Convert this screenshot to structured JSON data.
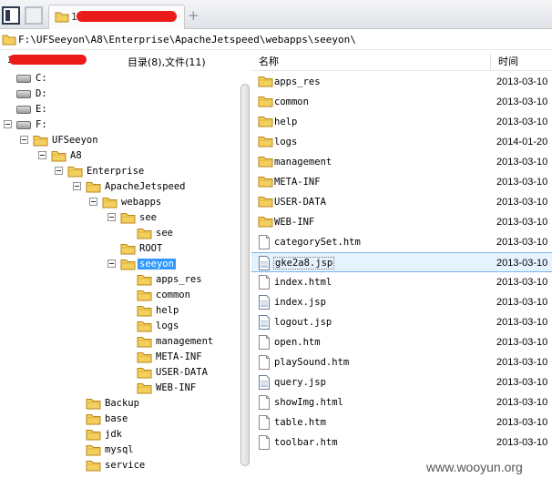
{
  "tab": {
    "title": "11..."
  },
  "path": {
    "text": "F:\\UFSeeyon\\A8\\Enterprise\\ApacheJetspeed\\webapps\\seeyon\\"
  },
  "left_header": {
    "host": "11...",
    "counts": "目录(8),文件(11)"
  },
  "tree": {
    "nodes": [
      {
        "label": "C:",
        "kind": "drive"
      },
      {
        "label": "D:",
        "kind": "drive"
      },
      {
        "label": "E:",
        "kind": "drive"
      },
      {
        "label": "F:",
        "kind": "drive"
      },
      {
        "label": "UFSeeyon",
        "kind": "folder"
      },
      {
        "label": "A8",
        "kind": "folder"
      },
      {
        "label": "Enterprise",
        "kind": "folder"
      },
      {
        "label": "ApacheJetspeed",
        "kind": "folder"
      },
      {
        "label": "webapps",
        "kind": "folder"
      },
      {
        "label": "see",
        "kind": "folder"
      },
      {
        "label": "see",
        "kind": "folder"
      },
      {
        "label": "ROOT",
        "kind": "folder"
      },
      {
        "label": "seeyon",
        "kind": "folder",
        "selected": true
      },
      {
        "label": "apps_res",
        "kind": "folder"
      },
      {
        "label": "common",
        "kind": "folder"
      },
      {
        "label": "help",
        "kind": "folder"
      },
      {
        "label": "logs",
        "kind": "folder"
      },
      {
        "label": "management",
        "kind": "folder"
      },
      {
        "label": "META-INF",
        "kind": "folder"
      },
      {
        "label": "USER-DATA",
        "kind": "folder"
      },
      {
        "label": "WEB-INF",
        "kind": "folder"
      },
      {
        "label": "Backup",
        "kind": "folder"
      },
      {
        "label": "base",
        "kind": "folder"
      },
      {
        "label": "jdk",
        "kind": "folder"
      },
      {
        "label": "mysql",
        "kind": "folder"
      },
      {
        "label": "service",
        "kind": "folder"
      }
    ]
  },
  "columns": {
    "name": "名称",
    "time": "时间"
  },
  "files": [
    {
      "name": "apps_res",
      "type": "folder",
      "time": "2013-03-10"
    },
    {
      "name": "common",
      "type": "folder",
      "time": "2013-03-10"
    },
    {
      "name": "help",
      "type": "folder",
      "time": "2013-03-10"
    },
    {
      "name": "logs",
      "type": "folder",
      "time": "2014-01-20"
    },
    {
      "name": "management",
      "type": "folder",
      "time": "2013-03-10"
    },
    {
      "name": "META-INF",
      "type": "folder",
      "time": "2013-03-10"
    },
    {
      "name": "USER-DATA",
      "type": "folder",
      "time": "2013-03-10"
    },
    {
      "name": "WEB-INF",
      "type": "folder",
      "time": "2013-03-10"
    },
    {
      "name": "categorySet.htm",
      "type": "doc",
      "time": "2013-03-10"
    },
    {
      "name": "gke2a8.jsp",
      "type": "jsp",
      "time": "2013-03-10",
      "selected": true
    },
    {
      "name": "index.html",
      "type": "doc",
      "time": "2013-03-10"
    },
    {
      "name": "index.jsp",
      "type": "jsp",
      "time": "2013-03-10"
    },
    {
      "name": "logout.jsp",
      "type": "jsp",
      "time": "2013-03-10"
    },
    {
      "name": "open.htm",
      "type": "doc",
      "time": "2013-03-10"
    },
    {
      "name": "playSound.htm",
      "type": "doc",
      "time": "2013-03-10"
    },
    {
      "name": "query.jsp",
      "type": "jsp",
      "time": "2013-03-10"
    },
    {
      "name": "showImg.html",
      "type": "doc",
      "time": "2013-03-10"
    },
    {
      "name": "table.htm",
      "type": "doc",
      "time": "2013-03-10"
    },
    {
      "name": "toolbar.htm",
      "type": "doc",
      "time": "2013-03-10"
    }
  ],
  "watermark": "www.wooyun.org",
  "colors": {
    "folder": "#f3cf5e",
    "folder_dark": "#d9a72c",
    "selection": "#3399ff",
    "redaction": "#ec1b1b"
  }
}
